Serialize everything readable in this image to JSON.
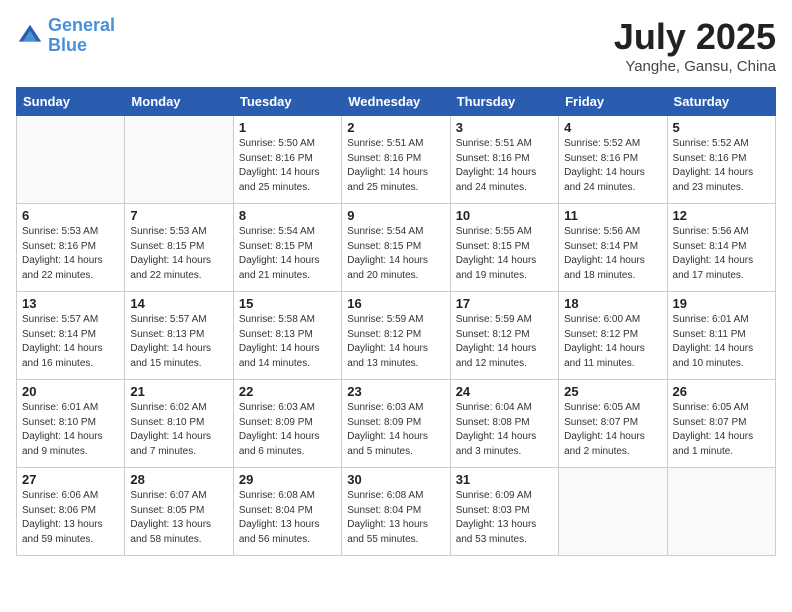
{
  "header": {
    "logo_line1": "General",
    "logo_line2": "Blue",
    "month": "July 2025",
    "location": "Yanghe, Gansu, China"
  },
  "days_of_week": [
    "Sunday",
    "Monday",
    "Tuesday",
    "Wednesday",
    "Thursday",
    "Friday",
    "Saturday"
  ],
  "weeks": [
    [
      {
        "day": "",
        "info": ""
      },
      {
        "day": "",
        "info": ""
      },
      {
        "day": "1",
        "info": "Sunrise: 5:50 AM\nSunset: 8:16 PM\nDaylight: 14 hours\nand 25 minutes."
      },
      {
        "day": "2",
        "info": "Sunrise: 5:51 AM\nSunset: 8:16 PM\nDaylight: 14 hours\nand 25 minutes."
      },
      {
        "day": "3",
        "info": "Sunrise: 5:51 AM\nSunset: 8:16 PM\nDaylight: 14 hours\nand 24 minutes."
      },
      {
        "day": "4",
        "info": "Sunrise: 5:52 AM\nSunset: 8:16 PM\nDaylight: 14 hours\nand 24 minutes."
      },
      {
        "day": "5",
        "info": "Sunrise: 5:52 AM\nSunset: 8:16 PM\nDaylight: 14 hours\nand 23 minutes."
      }
    ],
    [
      {
        "day": "6",
        "info": "Sunrise: 5:53 AM\nSunset: 8:16 PM\nDaylight: 14 hours\nand 22 minutes."
      },
      {
        "day": "7",
        "info": "Sunrise: 5:53 AM\nSunset: 8:15 PM\nDaylight: 14 hours\nand 22 minutes."
      },
      {
        "day": "8",
        "info": "Sunrise: 5:54 AM\nSunset: 8:15 PM\nDaylight: 14 hours\nand 21 minutes."
      },
      {
        "day": "9",
        "info": "Sunrise: 5:54 AM\nSunset: 8:15 PM\nDaylight: 14 hours\nand 20 minutes."
      },
      {
        "day": "10",
        "info": "Sunrise: 5:55 AM\nSunset: 8:15 PM\nDaylight: 14 hours\nand 19 minutes."
      },
      {
        "day": "11",
        "info": "Sunrise: 5:56 AM\nSunset: 8:14 PM\nDaylight: 14 hours\nand 18 minutes."
      },
      {
        "day": "12",
        "info": "Sunrise: 5:56 AM\nSunset: 8:14 PM\nDaylight: 14 hours\nand 17 minutes."
      }
    ],
    [
      {
        "day": "13",
        "info": "Sunrise: 5:57 AM\nSunset: 8:14 PM\nDaylight: 14 hours\nand 16 minutes."
      },
      {
        "day": "14",
        "info": "Sunrise: 5:57 AM\nSunset: 8:13 PM\nDaylight: 14 hours\nand 15 minutes."
      },
      {
        "day": "15",
        "info": "Sunrise: 5:58 AM\nSunset: 8:13 PM\nDaylight: 14 hours\nand 14 minutes."
      },
      {
        "day": "16",
        "info": "Sunrise: 5:59 AM\nSunset: 8:12 PM\nDaylight: 14 hours\nand 13 minutes."
      },
      {
        "day": "17",
        "info": "Sunrise: 5:59 AM\nSunset: 8:12 PM\nDaylight: 14 hours\nand 12 minutes."
      },
      {
        "day": "18",
        "info": "Sunrise: 6:00 AM\nSunset: 8:12 PM\nDaylight: 14 hours\nand 11 minutes."
      },
      {
        "day": "19",
        "info": "Sunrise: 6:01 AM\nSunset: 8:11 PM\nDaylight: 14 hours\nand 10 minutes."
      }
    ],
    [
      {
        "day": "20",
        "info": "Sunrise: 6:01 AM\nSunset: 8:10 PM\nDaylight: 14 hours\nand 9 minutes."
      },
      {
        "day": "21",
        "info": "Sunrise: 6:02 AM\nSunset: 8:10 PM\nDaylight: 14 hours\nand 7 minutes."
      },
      {
        "day": "22",
        "info": "Sunrise: 6:03 AM\nSunset: 8:09 PM\nDaylight: 14 hours\nand 6 minutes."
      },
      {
        "day": "23",
        "info": "Sunrise: 6:03 AM\nSunset: 8:09 PM\nDaylight: 14 hours\nand 5 minutes."
      },
      {
        "day": "24",
        "info": "Sunrise: 6:04 AM\nSunset: 8:08 PM\nDaylight: 14 hours\nand 3 minutes."
      },
      {
        "day": "25",
        "info": "Sunrise: 6:05 AM\nSunset: 8:07 PM\nDaylight: 14 hours\nand 2 minutes."
      },
      {
        "day": "26",
        "info": "Sunrise: 6:05 AM\nSunset: 8:07 PM\nDaylight: 14 hours\nand 1 minute."
      }
    ],
    [
      {
        "day": "27",
        "info": "Sunrise: 6:06 AM\nSunset: 8:06 PM\nDaylight: 13 hours\nand 59 minutes."
      },
      {
        "day": "28",
        "info": "Sunrise: 6:07 AM\nSunset: 8:05 PM\nDaylight: 13 hours\nand 58 minutes."
      },
      {
        "day": "29",
        "info": "Sunrise: 6:08 AM\nSunset: 8:04 PM\nDaylight: 13 hours\nand 56 minutes."
      },
      {
        "day": "30",
        "info": "Sunrise: 6:08 AM\nSunset: 8:04 PM\nDaylight: 13 hours\nand 55 minutes."
      },
      {
        "day": "31",
        "info": "Sunrise: 6:09 AM\nSunset: 8:03 PM\nDaylight: 13 hours\nand 53 minutes."
      },
      {
        "day": "",
        "info": ""
      },
      {
        "day": "",
        "info": ""
      }
    ]
  ]
}
